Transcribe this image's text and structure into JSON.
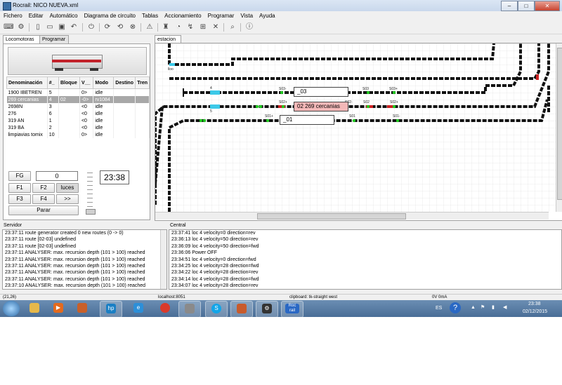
{
  "window": {
    "title": "Rocrail: NICO NUEVA.xml",
    "min": "–",
    "max": "□",
    "close": "✕"
  },
  "menu": [
    "Fichero",
    "Editar",
    "Automático",
    "Diagrama de circuito",
    "Tablas",
    "Accionamiento",
    "Programar",
    "Vista",
    "Ayuda"
  ],
  "left_tabs": {
    "locomotoras": "Locomotoras",
    "programar": "Programar"
  },
  "loco_table": {
    "headers": [
      "Denominación",
      "#_",
      "Bloque",
      "V__",
      "Modo",
      "Destino",
      "Tren"
    ],
    "rows": [
      [
        "1900 IBETREN",
        "5",
        "",
        "0>",
        "idle",
        "",
        ""
      ],
      [
        "269 cercanias",
        "4",
        "02",
        "-0>",
        "rv1084",
        "",
        ""
      ],
      [
        "2698N",
        "3",
        "",
        "<0",
        "idle",
        "",
        ""
      ],
      [
        "276",
        "6",
        "",
        "<0",
        "idle",
        "",
        ""
      ],
      [
        "319 AN",
        "1",
        "",
        "<0",
        "idle",
        "",
        ""
      ],
      [
        "319 BA",
        "2",
        "",
        "<0",
        "idle",
        "",
        ""
      ],
      [
        "limpiavias tomix",
        "10",
        "",
        "0>",
        "idle",
        "",
        ""
      ]
    ],
    "selected_index": 1
  },
  "controls": {
    "fg": "FG",
    "speed": "0",
    "f1": "F1",
    "f2": "F2",
    "luces": "luces",
    "f3": "F3",
    "f4": "F4",
    "next": ">>",
    "stop": "Parar",
    "clock": "23:38"
  },
  "plan": {
    "tab": "estacion",
    "blocks": {
      "b03": "_03",
      "b02": "02 269 cercanias",
      "b01": "_01"
    },
    "labels": {
      "lloo": "lloo",
      "n4": "4",
      "n5": "5",
      "s03a": "S03-",
      "s03b": "S03",
      "s03c": "S03+",
      "s02a": "S02+",
      "s02b": "S02-",
      "s02c": "S02",
      "s02d": "S02+",
      "s01a": "S01+",
      "s01b": "S01",
      "s01c": "S01-"
    }
  },
  "logs": {
    "server_label": "Servidor",
    "central_label": "Central",
    "server": [
      "23:37:11 route generator created 0 new routes (0 -> 0)",
      "23:37:11 route [02-03] undefined",
      "23:37:11 route [02-03] undefined",
      "23:37:11 ANALYSER: max. recursion depth (101 > 100) reached",
      "23:37:11 ANALYSER: max. recursion depth (101 > 100) reached",
      "23:37:11 ANALYSER: max. recursion depth (101 > 100) reached",
      "23:37:11 ANALYSER: max. recursion depth (101 > 100) reached",
      "23:37:11 ANALYSER: max. recursion depth (101 > 100) reached",
      "23:37:10 ANALYSER: max. recursion depth (101 > 100) reached"
    ],
    "central": [
      "23:37:41 loc 4 velocity=0 direction=rev",
      "23:36:13 loc 4 velocity=50 direction=rev",
      "23:36:09 loc 4 velocity=50 direction=fwd",
      "23:36:06 Power OFF",
      "23:34:51 loc 4 velocity=0 direction=fwd",
      "23:34:25 loc 4 velocity=28 direction=fwd",
      "23:34:22 loc 4 velocity=28 direction=rev",
      "23:34:14 loc 4 velocity=28 direction=fwd",
      "23:34:07 loc 4 velocity=28 direction=rev"
    ]
  },
  "status": {
    "coords": "(21,26)",
    "host": "localhost:8051",
    "clipboard": "clipboard: tk-straight west",
    "power": "0V 0mA"
  },
  "taskbar": {
    "apps": [
      "explorer",
      "media-player",
      "windows-media-player",
      "hp",
      "internet-explorer",
      "chrome",
      "photo-viewer",
      "skype",
      "mcafee",
      "settings",
      "rocrail"
    ],
    "rocrail_label": "Roc rail",
    "lang": "ES",
    "time": "23:38",
    "date": "02/12/2015"
  },
  "colors": {
    "accent": "#2d6aa6",
    "signal_green": "#22cc22",
    "signal_red": "#cc2222",
    "block_red": "#f4b8b8"
  }
}
